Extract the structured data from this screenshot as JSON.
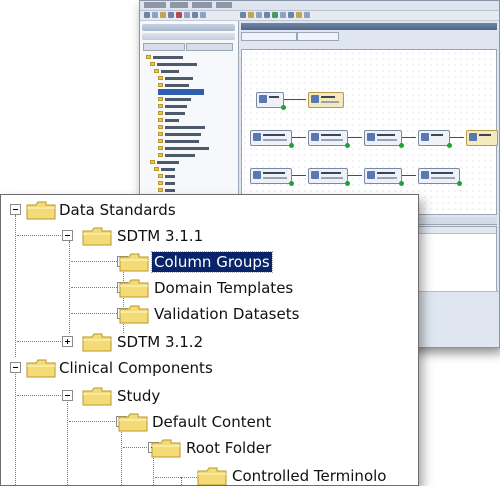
{
  "colors": {
    "selection": "#0a246a",
    "folder_fill": "#f3dc78",
    "folder_edge": "#b8962a",
    "node_marker": "#1aa532"
  },
  "icons": {
    "folder": "folder-icon",
    "expand": "plus-box-icon",
    "collapse": "minus-box-icon"
  },
  "tree": {
    "items": [
      {
        "label": "Data Standards",
        "state": "collapse",
        "depth": 0
      },
      {
        "label": "SDTM 3.1.1",
        "state": "collapse",
        "depth": 1
      },
      {
        "label": "Column Groups",
        "state": "expand",
        "depth": 2,
        "selected": true
      },
      {
        "label": "Domain Templates",
        "state": "expand",
        "depth": 2
      },
      {
        "label": "Validation Datasets",
        "state": "expand",
        "depth": 2
      },
      {
        "label": "SDTM 3.1.2",
        "state": "expand",
        "depth": 1
      },
      {
        "label": "Clinical Components",
        "state": "collapse",
        "depth": 0
      },
      {
        "label": "Study",
        "state": "collapse",
        "depth": 1
      },
      {
        "label": "Default Content",
        "state": "collapse",
        "depth": 2
      },
      {
        "label": "Root Folder",
        "state": "collapse",
        "depth": 3
      },
      {
        "label": "Controlled Terminolo",
        "state": "leaf",
        "depth": 4
      }
    ]
  }
}
